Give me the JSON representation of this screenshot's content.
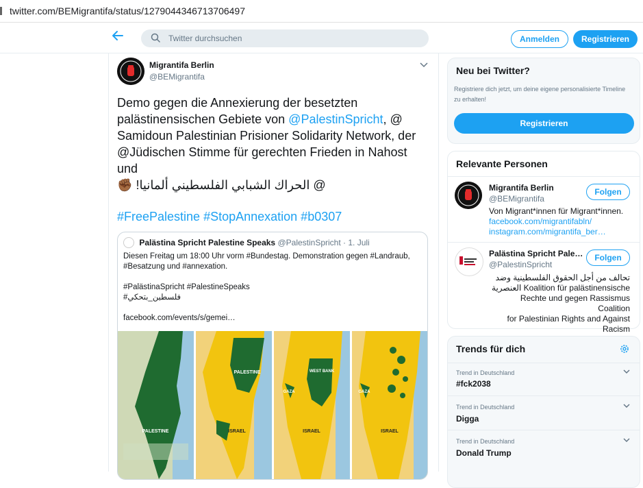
{
  "browser": {
    "url": "twitter.com/BEMigrantifa/status/1279044346713706497"
  },
  "header": {
    "search_placeholder": "Twitter durchsuchen",
    "login_label": "Anmelden",
    "signup_label": "Registrieren"
  },
  "tweet": {
    "author_name": "Migrantifa Berlin",
    "author_handle": "@BEMigrantifa",
    "lines": [
      {
        "text": "Demo gegen die Annexierung der besetzten",
        "link": ""
      },
      {
        "text": "palästinensischen Gebiete von ",
        "link": "@PalestinSpricht",
        "after": ", @"
      },
      {
        "text": "Samidoun Palestinian Prisioner Solidarity Network, der",
        "link": ""
      },
      {
        "text": "@Jüdischen Stimme für gerechten Frieden in Nahost",
        "link": ""
      },
      {
        "text": "und",
        "link": ""
      }
    ],
    "arabic_line": "@ الحراك الشبابي الفلسطيني ألمانيا!",
    "emoji": "✊🏾",
    "hashtags": "#FreePalestine #StopAnnexation #b0307",
    "quote": {
      "name": "Palästina Spricht Palestine Speaks",
      "handle": "@PalestinSpricht",
      "date": "· 1. Juli",
      "lines": [
        "Diesen Freitag um 18:00 Uhr vorm #Bundestag. Demonstration gegen #Landraub,",
        "#Besatzung und #annexation.",
        "",
        "#PalästinaSpricht #PalestineSpeaks",
        "#فلسطين_بتحكي",
        "",
        "facebook.com/events/s/gemei…"
      ],
      "map_labels": [
        "PALESTINE",
        "PALESTINE",
        "ISRAEL",
        "WEST BANK",
        "GAZA",
        "ISRAEL",
        "GAZA",
        "ISRAEL"
      ]
    }
  },
  "sidebar": {
    "new": {
      "title": "Neu bei Twitter?",
      "desc": "Registriere dich jetzt, um deine eigene personalisierte Timeline zu erhalten!",
      "cta": "Registrieren"
    },
    "people": {
      "title": "Relevante Personen",
      "follow_label": "Folgen",
      "p1": {
        "name": "Migrantifa Berlin",
        "handle": "@BEMigrantifa",
        "bio": "Von Migrant*innen für Migrant*innen.",
        "link1": "facebook.com/migrantifabln/",
        "link2": "instagram.com/migrantifa_ber…"
      },
      "p2": {
        "name": "Palästina Spricht Pale…",
        "handle": "@PalestinSpricht",
        "bio_lines": [
          "تحالف من أجل الحقوق الفلسطينية وضد",
          "العنصرية Koalition für palästinensische",
          "Rechte und gegen Rassismus Coalition",
          "for Palestinian Rights and Against",
          "Racism"
        ]
      }
    },
    "trends": {
      "title": "Trends für dich",
      "items": [
        {
          "meta": "Trend in Deutschland",
          "name": "#fck2038"
        },
        {
          "meta": "Trend in Deutschland",
          "name": "Digga"
        },
        {
          "meta": "Trend in Deutschland",
          "name": "Donald Trump"
        }
      ]
    }
  },
  "colors": {
    "accent": "#1da1f2",
    "map_green": "#1f6b30",
    "map_yellow": "#f2c40f"
  }
}
